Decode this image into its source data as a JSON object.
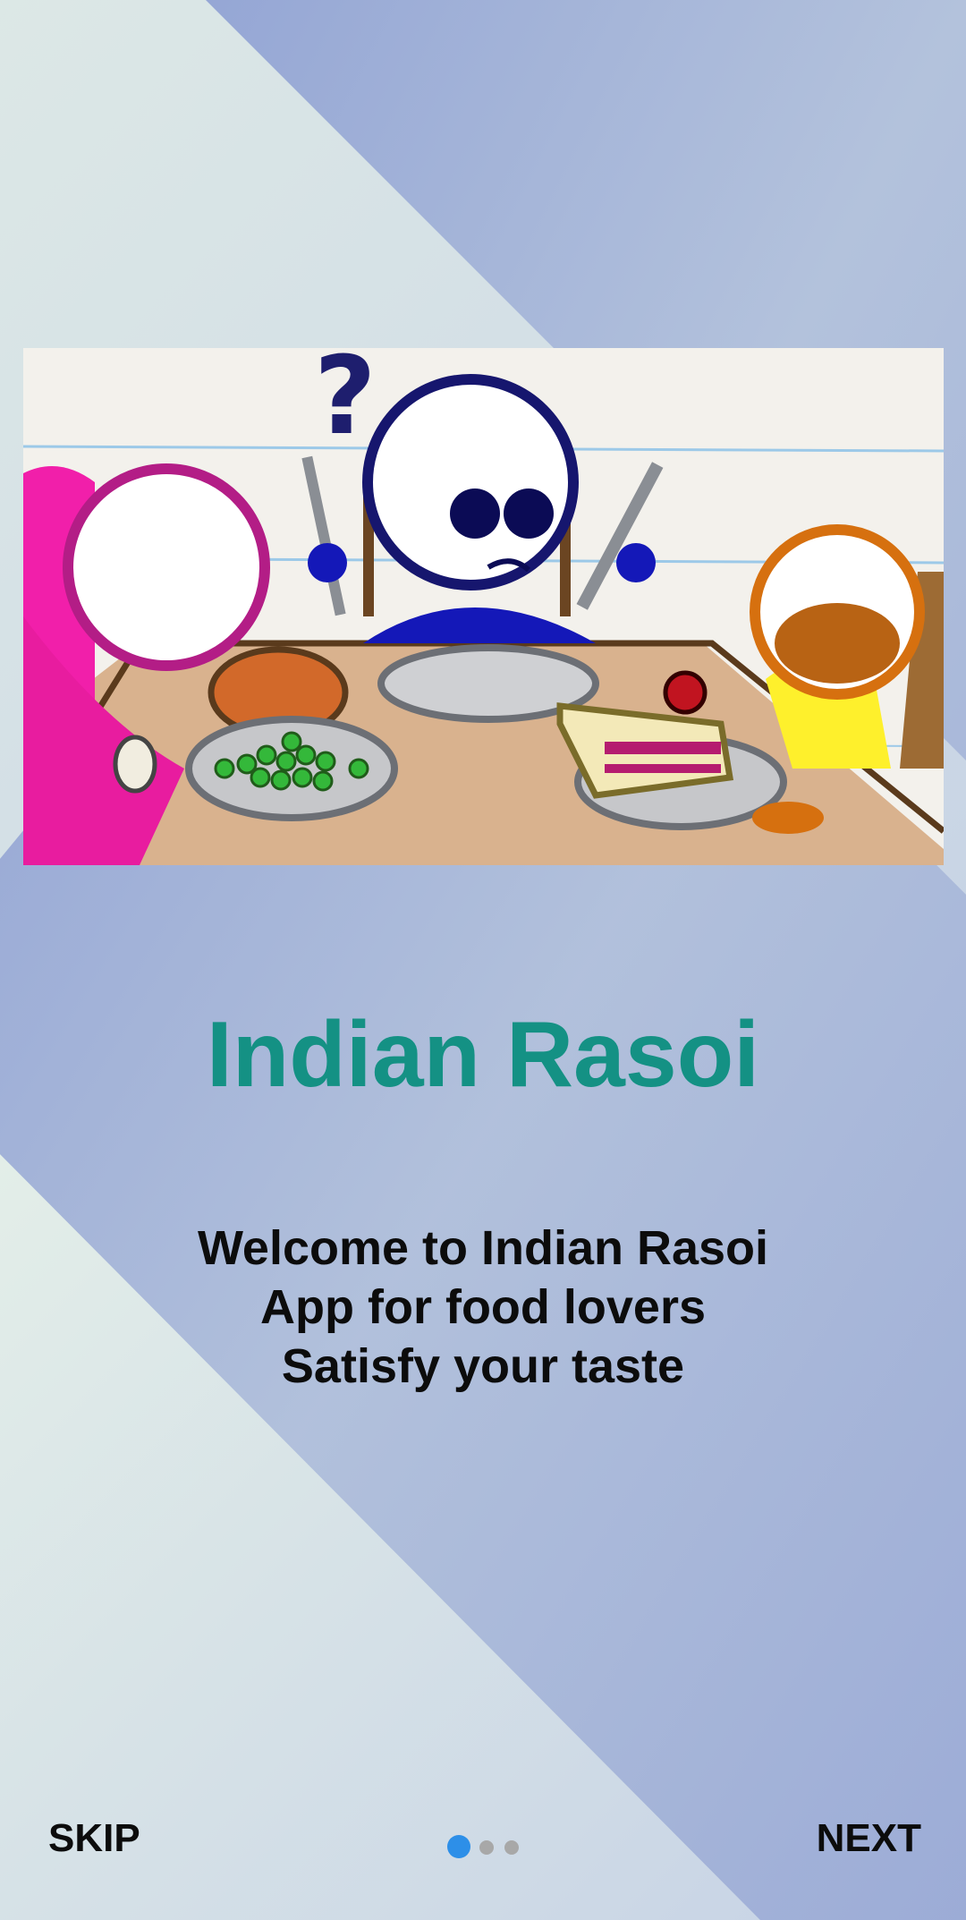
{
  "colors": {
    "bg_light": "#e1ede6",
    "bg_blue": "#9aaad6",
    "title": "#149184",
    "text": "#0c0c0c",
    "dot_active": "#2d8fe8",
    "dot_inactive": "#a8a8a8"
  },
  "illustration": {
    "icon": "cartoon-dinner-illustration"
  },
  "onboarding": {
    "title": "Indian Rasoi",
    "lines": [
      "Welcome to Indian Rasoi",
      "App for food lovers",
      "Satisfy your taste"
    ]
  },
  "footer": {
    "skip_label": "SKIP",
    "next_label": "NEXT",
    "page_count": 3,
    "active_page": 1
  }
}
